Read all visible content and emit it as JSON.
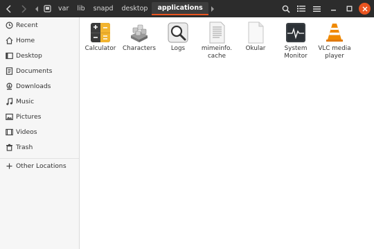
{
  "toolbar": {
    "back_icon": "chevron-left-icon",
    "forward_icon": "chevron-right-icon",
    "search_icon": "search-icon",
    "view_icon": "list-view-icon",
    "menu_icon": "hamburger-menu-icon"
  },
  "path": {
    "crumbs": [
      "var",
      "lib",
      "snapd",
      "desktop",
      "applications"
    ],
    "active": "applications"
  },
  "sidebar": {
    "items": [
      {
        "label": "Recent",
        "icon": "clock-icon"
      },
      {
        "label": "Home",
        "icon": "home-icon"
      },
      {
        "label": "Desktop",
        "icon": "desktop-icon"
      },
      {
        "label": "Documents",
        "icon": "documents-icon"
      },
      {
        "label": "Downloads",
        "icon": "download-icon"
      },
      {
        "label": "Music",
        "icon": "music-icon"
      },
      {
        "label": "Pictures",
        "icon": "pictures-icon"
      },
      {
        "label": "Videos",
        "icon": "videos-icon"
      },
      {
        "label": "Trash",
        "icon": "trash-icon"
      }
    ],
    "other": {
      "label": "Other Locations",
      "icon": "plus-icon"
    }
  },
  "files": [
    {
      "label": "Calculator",
      "icon": "calculator-icon"
    },
    {
      "label": "Characters",
      "icon": "characters-icon"
    },
    {
      "label": "Logs",
      "icon": "logs-icon"
    },
    {
      "label": "mimeinfo.\ncache",
      "icon": "text-file-icon"
    },
    {
      "label": "Okular",
      "icon": "document-file-icon"
    },
    {
      "label": "System\nMonitor",
      "icon": "system-monitor-icon"
    },
    {
      "label": "VLC media\nplayer",
      "icon": "vlc-cone-icon"
    }
  ],
  "colors": {
    "accent": "#e95420",
    "headerbar": "#2c2c2c",
    "sidebar": "#f6f6f6"
  }
}
